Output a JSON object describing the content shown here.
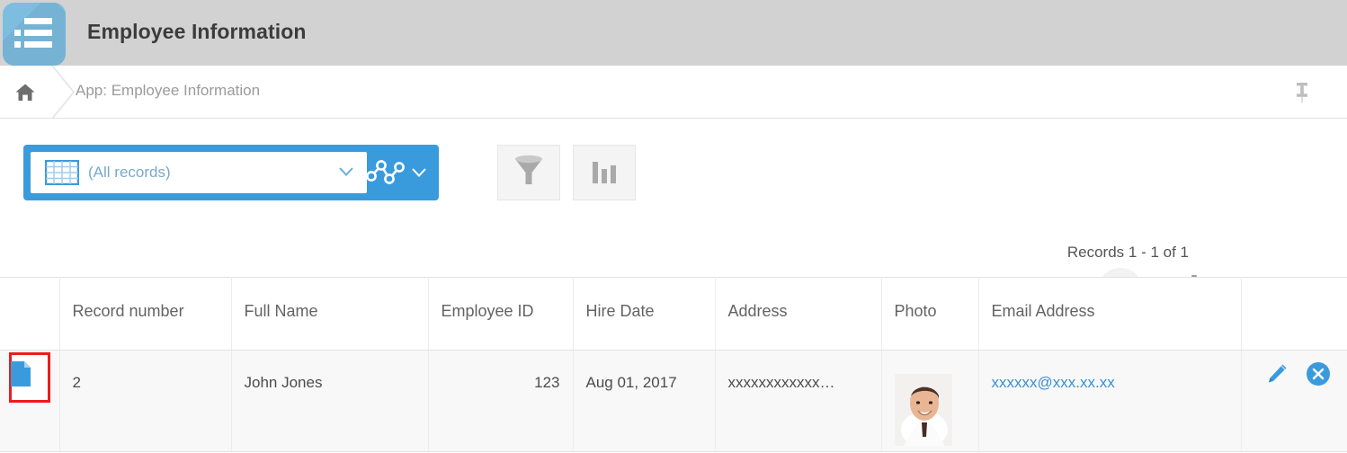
{
  "titlebar": {
    "app_icon_name": "list-app-icon",
    "title": "Employee Information",
    "background_color": "#d2d2d2",
    "icon_color": "#7cbde0"
  },
  "breadcrumb": {
    "home_icon": "home-icon",
    "label": "App: Employee Information",
    "pin_icon": "pin-icon"
  },
  "toolbar": {
    "view_select": {
      "icon": "grid-table-icon",
      "value": "(All records)",
      "caret": "chevron-down-icon"
    },
    "graph_button": {
      "icon": "line-graph-icon",
      "caret": "chevron-down-icon"
    },
    "filter_button": {
      "icon": "funnel-filter-icon"
    },
    "chart_button": {
      "icon": "bar-chart-icon"
    },
    "add_button": {
      "icon": "plus-icon"
    },
    "settings_button": {
      "icon": "gear-icon",
      "caret": "chevron-down-icon"
    },
    "more_button": {
      "icon": "ellipsis-icon"
    },
    "accent_color": "#3a9bdc"
  },
  "records": {
    "count_label": "Records 1 - 1 of 1"
  },
  "table": {
    "columns": [
      "",
      "Record number",
      "Full Name",
      "Employee ID",
      "Hire Date",
      "Address",
      "Photo",
      "Email Address",
      ""
    ],
    "rows": [
      {
        "record_icon": "document-icon",
        "record_number": "2",
        "full_name": "John Jones",
        "employee_id": "123",
        "hire_date": "Aug 01, 2017",
        "address": "xxxxxxxxxxxx…",
        "photo_alt": "employee-photo",
        "email": "xxxxxx@xxx.xx.xx",
        "edit_icon": "pencil-edit-icon",
        "delete_icon": "delete-circle-icon"
      }
    ]
  },
  "highlight": {
    "color": "#ee1c1c",
    "target": "record-document-icon"
  }
}
